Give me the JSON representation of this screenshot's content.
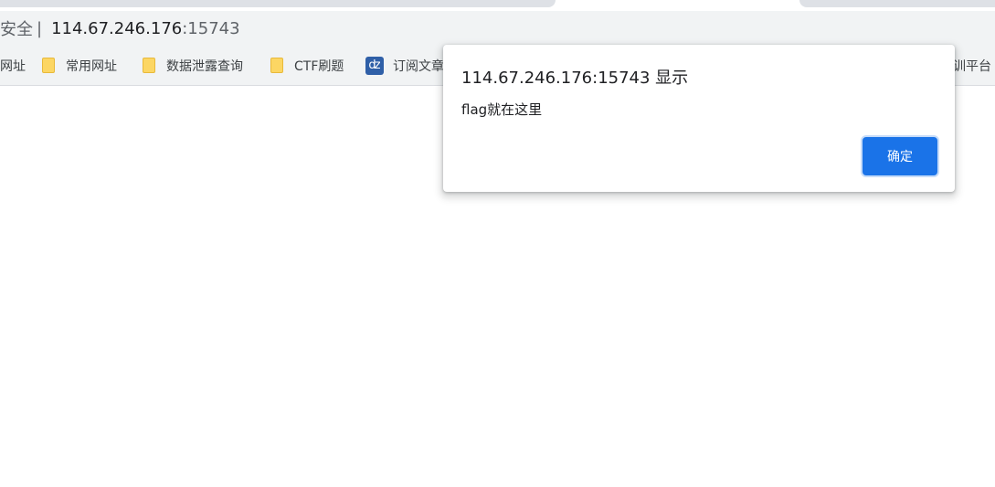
{
  "address_bar": {
    "security_label": "安全",
    "separator": "|",
    "host": "114.67.246.176",
    "port": ":15743"
  },
  "bookmarks": [
    {
      "label": "网址",
      "icon": "none"
    },
    {
      "label": "常用网址",
      "icon": "folder-icon"
    },
    {
      "label": "数据泄露查询",
      "icon": "folder-icon"
    },
    {
      "label": "CTF刷题",
      "icon": "folder-icon"
    },
    {
      "label": "订阅文章",
      "icon": "rss-icon"
    },
    {
      "label": "训平台",
      "icon": "none"
    }
  ],
  "dialog": {
    "title": "114.67.246.176:15743 显示",
    "message": "flag就在这里",
    "ok_label": "确定"
  },
  "colors": {
    "accent": "#1a73e8",
    "toolbar_bg": "#f1f3f4",
    "tab_bg": "#dee1e6",
    "folder": "#fcd663"
  }
}
